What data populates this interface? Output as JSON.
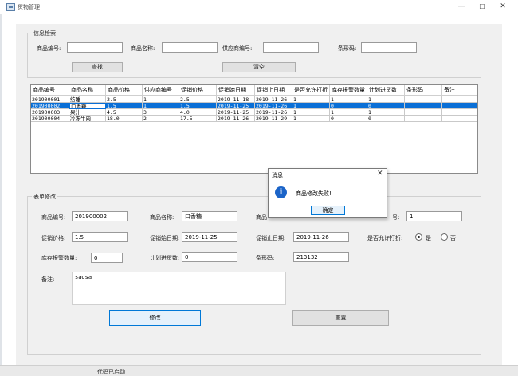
{
  "window": {
    "title": "货物管理",
    "minimize": "—",
    "maximize": "☐",
    "close": "✕"
  },
  "search": {
    "legend": "信息检索",
    "code_label": "商品编号:",
    "code_value": "",
    "name_label": "商品名称:",
    "name_value": "",
    "supplier_label": "供应商编号:",
    "supplier_value": "",
    "barcode_label": "条形码:",
    "barcode_value": "",
    "search_button": "查找",
    "clear_button": "清空"
  },
  "table": {
    "columns": [
      "商品编号",
      "商品名称",
      "商品价格",
      "供应商编号",
      "促销价格",
      "促销始日期",
      "促销止日期",
      "是否允许打折",
      "库存报警数量",
      "计划进货数",
      "条形码",
      "备注"
    ],
    "rows": [
      [
        "201900001",
        "纺睡",
        "2.5",
        "1",
        "2.5",
        "2019-11-18",
        "2019-11-26",
        "1",
        "1",
        "1",
        "",
        ""
      ],
      [
        "201900002",
        "口香糖",
        "1.5",
        "1",
        "1.5",
        "2019-11-25",
        "2019-11-26",
        "1",
        "0",
        "0",
        "",
        ""
      ],
      [
        "201900003",
        "果汁",
        "4.5",
        "3",
        "4.0",
        "2019-11-25",
        "2019-11-26",
        "1",
        "1",
        "1",
        "",
        ""
      ],
      [
        "201900004",
        "冷冻牛肉",
        "18.0",
        "2",
        "17.5",
        "2019-11-26",
        "2019-11-29",
        "1",
        "0",
        "0",
        "",
        ""
      ]
    ],
    "selected_row": 1
  },
  "form": {
    "legend": "表单修改",
    "code_label": "商品编号:",
    "code_value": "201900002",
    "name_label": "商品名称:",
    "name_value": "口香糖",
    "price_label_partial": "商品",
    "supplier_label_partial": "号:",
    "supplier_value": "1",
    "promo_price_label": "促销价格:",
    "promo_price_value": "1.5",
    "promo_start_label": "促销始日期:",
    "promo_start_value": "2019-11-25",
    "promo_end_label": "促销止日期:",
    "promo_end_value": "2019-11-26",
    "discount_label": "是否允许打折:",
    "discount_yes": "是",
    "discount_no": "否",
    "discount_selected": "是",
    "alarm_label": "库存报警数量:",
    "alarm_value": "0",
    "plan_label": "计划进货数:",
    "plan_value": "0",
    "barcode_label": "条形码:",
    "barcode_value": "213132",
    "note_label": "备注:",
    "note_value": "sadsa",
    "modify_button": "修改",
    "reset_button": "重置"
  },
  "dialog": {
    "title": "消息",
    "message": "商品修改失败!",
    "ok_button": "确定",
    "close": "✕",
    "icon": "info-icon"
  },
  "taskbar_text": "代码已启动"
}
